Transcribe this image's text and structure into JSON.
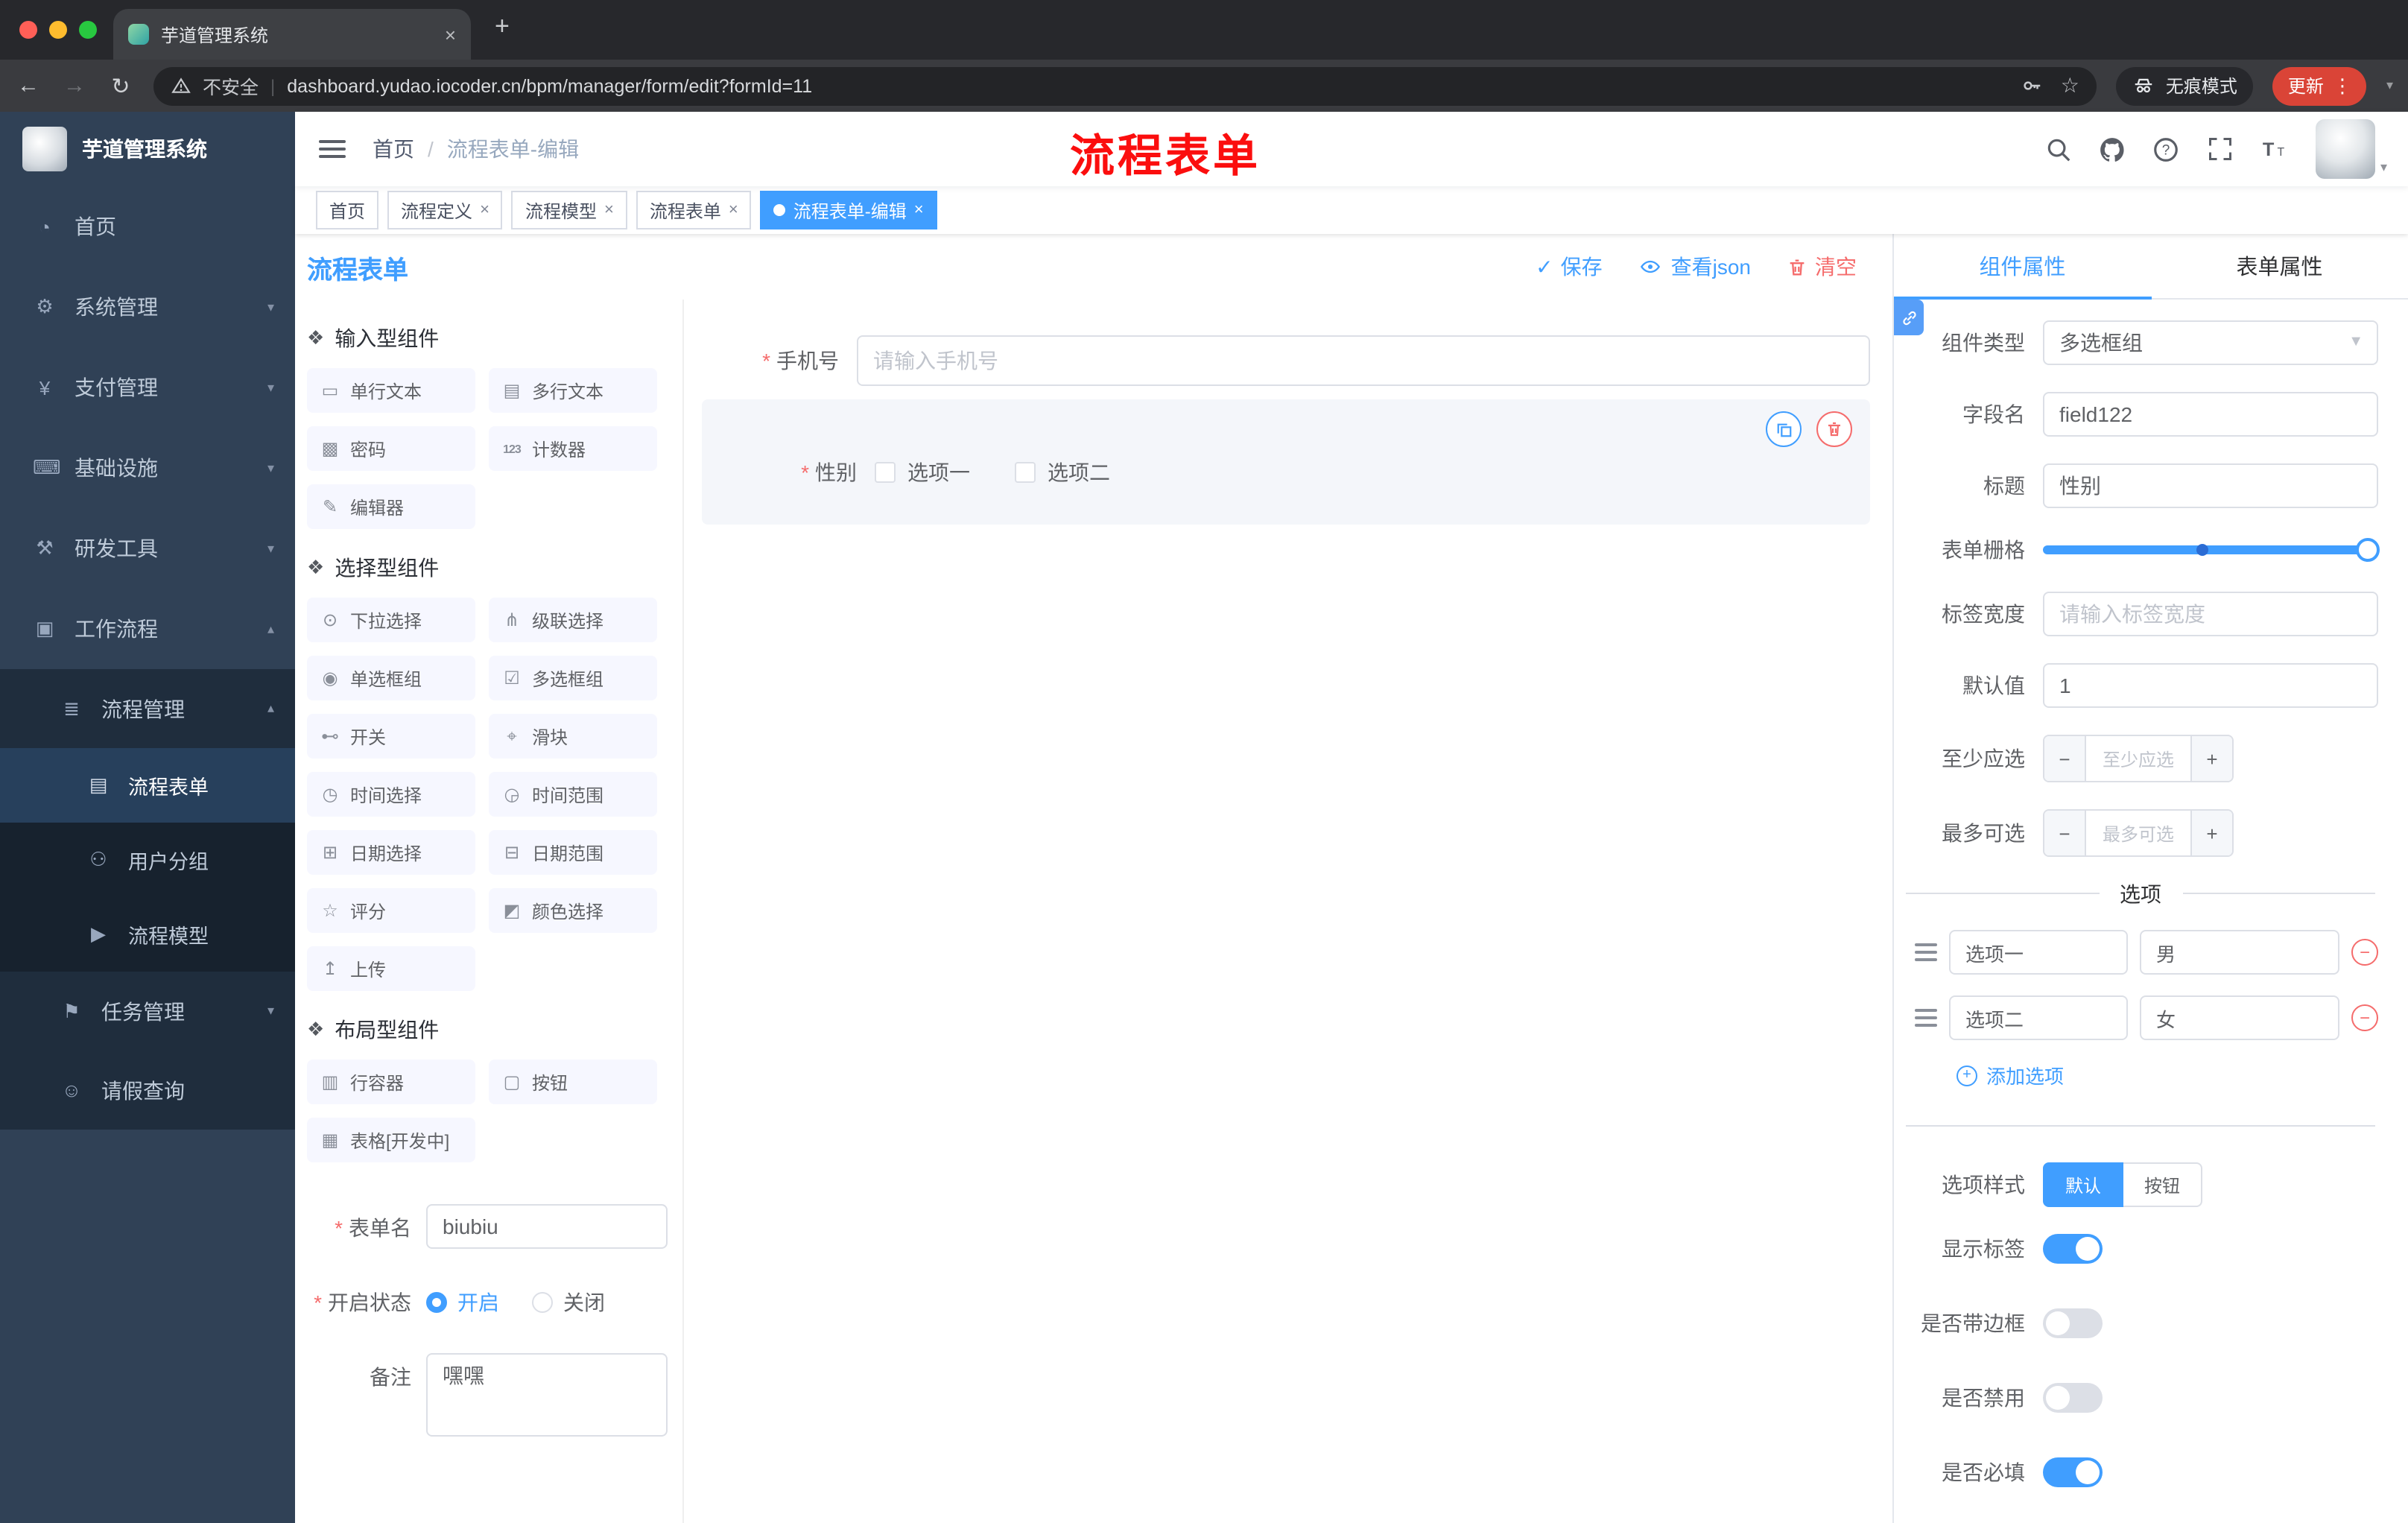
{
  "browser": {
    "tab_title": "芋道管理系统",
    "security_label": "不安全",
    "url": "dashboard.yudao.iocoder.cn/bpm/manager/form/edit?formId=11",
    "incognito_label": "无痕模式",
    "update_label": "更新"
  },
  "sidebar": {
    "logo_title": "芋道管理系统",
    "menu": [
      {
        "label": "首页",
        "icon": "◔"
      },
      {
        "label": "系统管理",
        "icon": "⚙"
      },
      {
        "label": "支付管理",
        "icon": "¥"
      },
      {
        "label": "基础设施",
        "icon": "⌨"
      },
      {
        "label": "研发工具",
        "icon": "⚒"
      },
      {
        "label": "工作流程",
        "icon": "▣"
      },
      {
        "label": "流程管理",
        "icon": "≣"
      },
      {
        "label": "流程表单",
        "icon": "▤"
      },
      {
        "label": "用户分组",
        "icon": "⚇"
      },
      {
        "label": "流程模型",
        "icon": "▶"
      },
      {
        "label": "任务管理",
        "icon": "⚑"
      },
      {
        "label": "请假查询",
        "icon": "☺"
      }
    ]
  },
  "navbar": {
    "breadcrumb": {
      "home": "首页",
      "separator": "/",
      "current": "流程表单-编辑"
    },
    "annotation": "流程表单"
  },
  "tags": {
    "items": [
      {
        "label": "首页"
      },
      {
        "label": "流程定义"
      },
      {
        "label": "流程模型"
      },
      {
        "label": "流程表单"
      },
      {
        "label": "流程表单-编辑"
      }
    ]
  },
  "designer": {
    "title": "流程表单",
    "actions": {
      "save": "保存",
      "view_json": "查看json",
      "clear": "清空"
    },
    "groups": [
      {
        "title": "输入型组件",
        "items": [
          {
            "label": "单行文本",
            "icon": "▭"
          },
          {
            "label": "多行文本",
            "icon": "▤"
          },
          {
            "label": "密码",
            "icon": "▩"
          },
          {
            "label": "计数器",
            "icon": "123"
          },
          {
            "label": "编辑器",
            "icon": "✎"
          }
        ]
      },
      {
        "title": "选择型组件",
        "items": [
          {
            "label": "下拉选择",
            "icon": "⊙"
          },
          {
            "label": "级联选择",
            "icon": "⋔"
          },
          {
            "label": "单选框组",
            "icon": "◉"
          },
          {
            "label": "多选框组",
            "icon": "☑"
          },
          {
            "label": "开关",
            "icon": "⊷"
          },
          {
            "label": "滑块",
            "icon": "⌖"
          },
          {
            "label": "时间选择",
            "icon": "◷"
          },
          {
            "label": "时间范围",
            "icon": "◶"
          },
          {
            "label": "日期选择",
            "icon": "⊞"
          },
          {
            "label": "日期范围",
            "icon": "⊟"
          },
          {
            "label": "评分",
            "icon": "☆"
          },
          {
            "label": "颜色选择",
            "icon": "◩"
          },
          {
            "label": "上传",
            "icon": "↥"
          }
        ]
      },
      {
        "title": "布局型组件",
        "items": [
          {
            "label": "行容器",
            "icon": "▥"
          },
          {
            "label": "按钮",
            "icon": "▢"
          },
          {
            "label": "表格[开发中]",
            "icon": "▦"
          }
        ]
      }
    ],
    "meta": {
      "name_label": "表单名",
      "name_value": "biubiu",
      "status_label": "开启状态",
      "status_on": "开启",
      "status_off": "关闭",
      "remark_label": "备注",
      "remark_value": "嘿嘿"
    }
  },
  "canvas": {
    "phone": {
      "label": "手机号",
      "placeholder": "请输入手机号"
    },
    "gender": {
      "label": "性别",
      "option1": "选项一",
      "option2": "选项二"
    }
  },
  "props": {
    "tab_component": "组件属性",
    "tab_form": "表单属性",
    "type_label": "组件类型",
    "type_value": "多选框组",
    "field_label": "字段名",
    "field_value": "field122",
    "title_label": "标题",
    "title_value": "性别",
    "grid_label": "表单栅格",
    "label_width_label": "标签宽度",
    "label_width_placeholder": "请输入标签宽度",
    "default_label": "默认值",
    "default_value": "1",
    "min_label": "至少应选",
    "min_placeholder": "至少应选",
    "max_label": "最多可选",
    "max_placeholder": "最多可选",
    "options_title": "选项",
    "options": [
      {
        "label": "选项一",
        "value": "男"
      },
      {
        "label": "选项二",
        "value": "女"
      }
    ],
    "add_option": "添加选项",
    "style_label": "选项样式",
    "style_default": "默认",
    "style_button": "按钮",
    "switch_show_label": "显示标签",
    "switch_border": "是否带边框",
    "switch_disabled": "是否禁用",
    "switch_required": "是否必填"
  },
  "colors": {
    "primary": "#409eff",
    "danger": "#f56c6c",
    "sidebar": "#304156"
  }
}
